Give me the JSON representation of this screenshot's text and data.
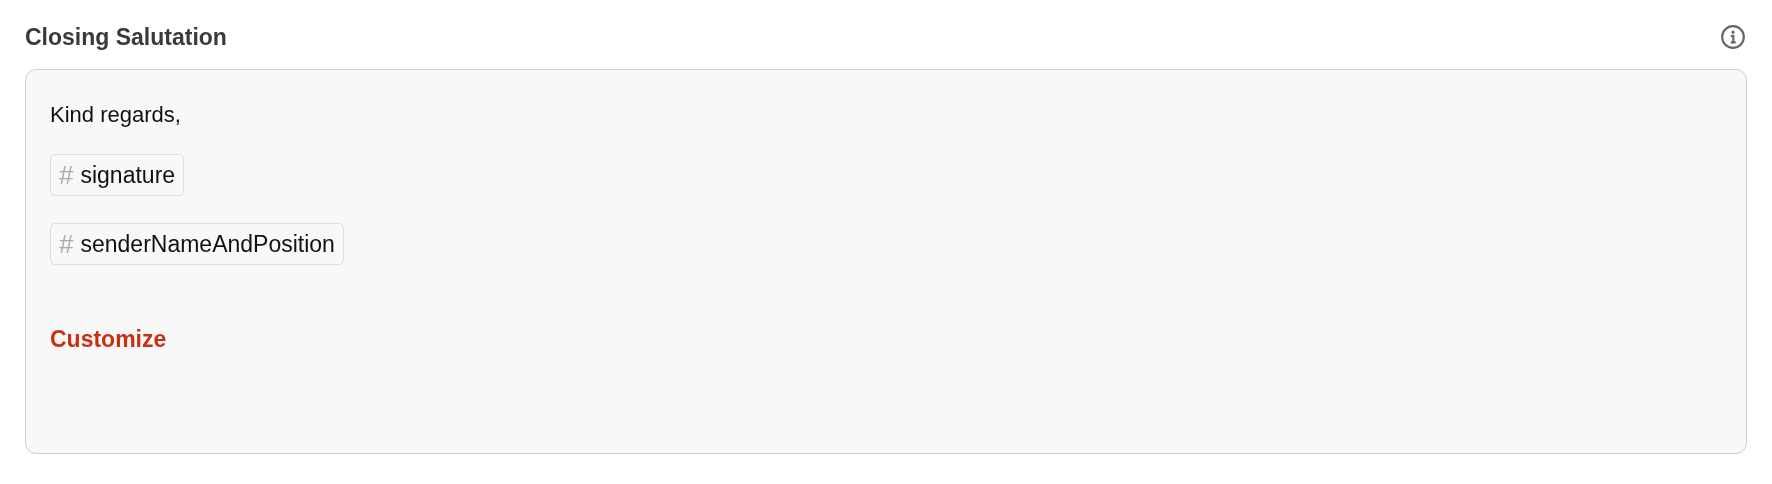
{
  "section": {
    "title": "Closing Salutation"
  },
  "content": {
    "greeting": "Kind regards,",
    "variables": [
      {
        "symbol": "#",
        "name": "signature"
      },
      {
        "symbol": "#",
        "name": "senderNameAndPosition"
      }
    ],
    "link": "Customize"
  }
}
